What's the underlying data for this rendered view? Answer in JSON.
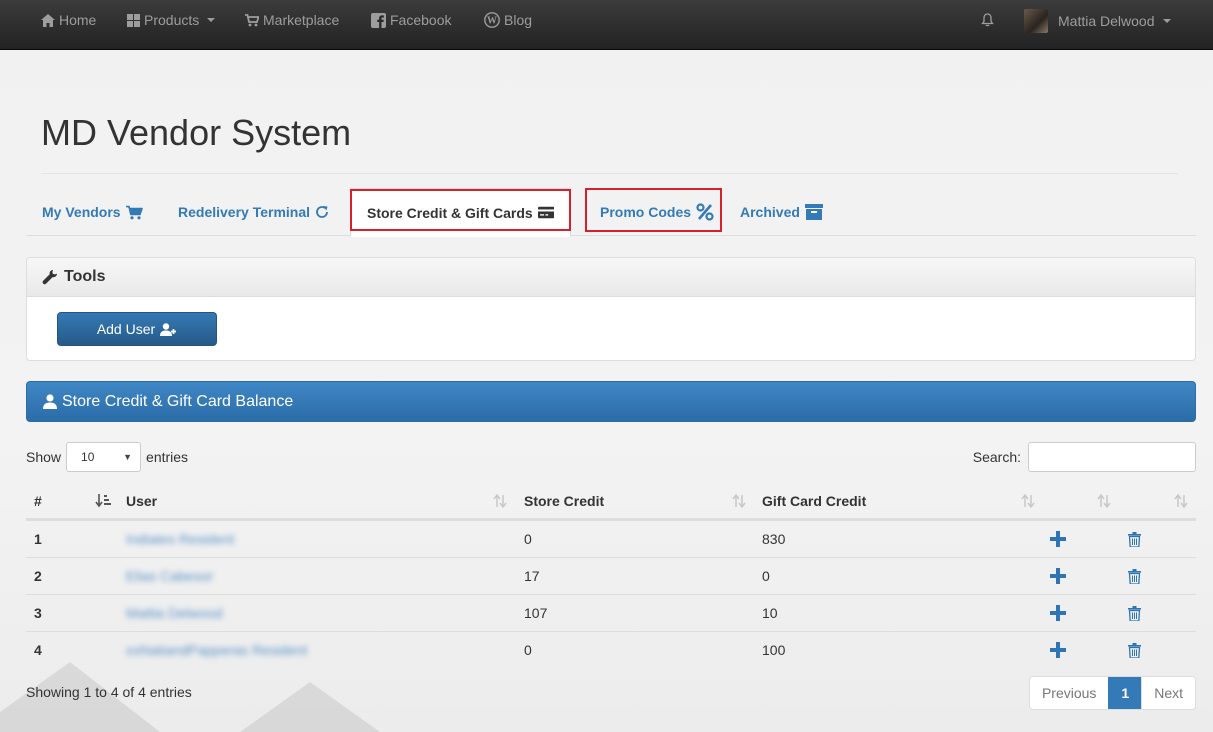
{
  "nav": {
    "home": "Home",
    "products": "Products",
    "marketplace": "Marketplace",
    "facebook": "Facebook",
    "blog": "Blog",
    "user_name": "Mattia Delwood"
  },
  "page": {
    "title": "MD Vendor System"
  },
  "tabs": [
    {
      "label": "My Vendors",
      "icon": "cart-icon"
    },
    {
      "label": "Redelivery Terminal",
      "icon": "refresh-icon"
    },
    {
      "label": "Store Credit & Gift Cards",
      "icon": "credit-card-icon",
      "active": true
    },
    {
      "label": "Promo Codes",
      "icon": "percent-icon"
    },
    {
      "label": "Archived",
      "icon": "archive-icon"
    }
  ],
  "tools": {
    "title": "Tools",
    "add_user": "Add User"
  },
  "balance": {
    "title": "Store Credit & Gift Card Balance"
  },
  "table_controls": {
    "show": "Show",
    "length": "10",
    "entries": "entries",
    "search": "Search:"
  },
  "table": {
    "columns": [
      "#",
      "User",
      "Store Credit",
      "Gift Card Credit"
    ],
    "rows": [
      {
        "num": "1",
        "user": "Indiates Resident",
        "store": "0",
        "gift": "830"
      },
      {
        "num": "2",
        "user": "Elias Cabesor",
        "store": "17",
        "gift": "0"
      },
      {
        "num": "3",
        "user": "Mattia Delwood",
        "store": "107",
        "gift": "10"
      },
      {
        "num": "4",
        "user": "xxNatiandPapperas Resident",
        "store": "0",
        "gift": "100"
      }
    ]
  },
  "footer": {
    "info": "Showing 1 to 4 of 4 entries",
    "previous": "Previous",
    "page": "1",
    "next": "Next"
  },
  "colors": {
    "brand": "#337ab7",
    "highlight": "#d9202a",
    "navbar": "#222222"
  }
}
